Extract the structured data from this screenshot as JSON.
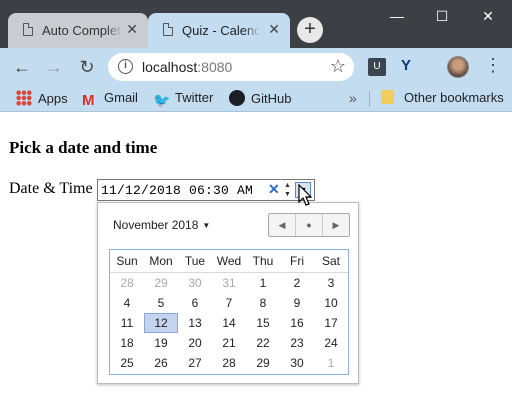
{
  "browser": {
    "tabs": [
      {
        "title": "Auto Complete"
      },
      {
        "title": "Quiz - Calendar"
      }
    ],
    "new_tab_label": "+",
    "window_controls": {
      "minimize": "—",
      "maximize": "☐",
      "close": "✕"
    },
    "address": {
      "host": "localhost",
      "port": ":8080"
    },
    "bookmarks": [
      {
        "label": "Apps",
        "icon": "apps-icon"
      },
      {
        "label": "Gmail",
        "icon": "gmail-icon"
      },
      {
        "label": "Twitter",
        "icon": "twitter-icon"
      },
      {
        "label": "GitHub",
        "icon": "github-icon"
      }
    ],
    "other_bookmarks": "Other bookmarks"
  },
  "page": {
    "heading": "Pick a date and time",
    "field_label": "Date & Time",
    "field_value": "11/12/2018 06:30 AM"
  },
  "calendar": {
    "month_label": "November 2018",
    "weekdays": [
      "Sun",
      "Mon",
      "Tue",
      "Wed",
      "Thu",
      "Fri",
      "Sat"
    ],
    "weeks": [
      [
        "28",
        "29",
        "30",
        "31",
        "1",
        "2",
        "3"
      ],
      [
        "4",
        "5",
        "6",
        "7",
        "8",
        "9",
        "10"
      ],
      [
        "11",
        "12",
        "13",
        "14",
        "15",
        "16",
        "17"
      ],
      [
        "18",
        "19",
        "20",
        "21",
        "22",
        "23",
        "24"
      ],
      [
        "25",
        "26",
        "27",
        "28",
        "29",
        "30",
        "1"
      ]
    ],
    "selected_day": "12",
    "colors": {
      "selected": "#c4d4ee",
      "grid_border": "#8ab2dc",
      "other_month": "#aaaaaa"
    }
  }
}
